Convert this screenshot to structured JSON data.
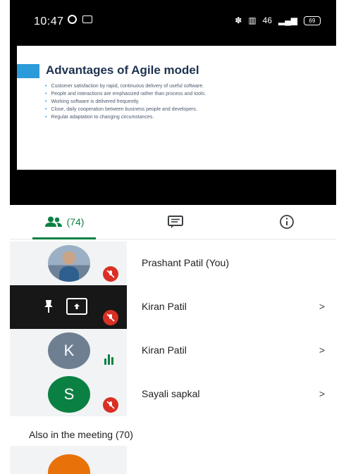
{
  "status_bar": {
    "time": "10:47",
    "network_label": "46",
    "battery": "69"
  },
  "slide": {
    "title": "Advantages of Agile model",
    "bullets": [
      "Customer satisfaction by rapid, continuous delivery of useful software.",
      "People and interactions are emphasized rather than process and tools.",
      "Working software is delivered frequently.",
      "Close, daily cooperation between business people and developers.",
      "Regular adaptation to changing circumstances."
    ],
    "accent_color": "#2b9bd9"
  },
  "tabs": {
    "people_count": "(74)",
    "active": "people",
    "accent_color": "#0b8043"
  },
  "participants": [
    {
      "name": "Prashant Patil (You)",
      "avatar": "photo",
      "state": "muted",
      "chevron": ""
    },
    {
      "name": "Kiran Patil",
      "avatar": "presenting",
      "state": "muted",
      "chevron": ">"
    },
    {
      "name": "Kiran Patil",
      "avatar": "K",
      "state": "speaking",
      "chevron": ">"
    },
    {
      "name": "Sayali sapkal",
      "avatar": "S",
      "state": "muted",
      "chevron": ">"
    }
  ],
  "also_in_meeting": "Also in the meeting (70)"
}
